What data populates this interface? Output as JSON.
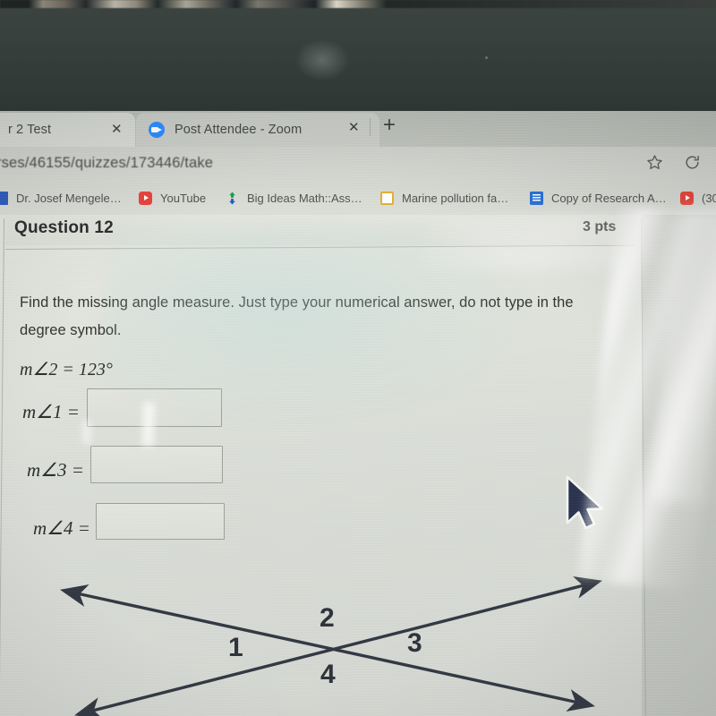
{
  "browser": {
    "tabs": [
      {
        "title": "r 2 Test",
        "favicon": "partial-tab-icon",
        "close_label": "✕",
        "active": false
      },
      {
        "title": "Post Attendee - Zoom",
        "favicon": "zoom-icon",
        "close_label": "✕",
        "active": true
      }
    ],
    "new_tab_label": "+",
    "url": "rses/46155/quizzes/173446/take",
    "toolbar_icons": [
      "bookmark-star-icon",
      "reload-icon"
    ],
    "bookmarks": [
      {
        "label": "Dr. Josef Mengele…",
        "icon": "blue-doc-icon"
      },
      {
        "label": "YouTube",
        "icon": "youtube-icon"
      },
      {
        "label": "Big Ideas Math::Ass…",
        "icon": "big-ideas-math-icon"
      },
      {
        "label": "Marine pollution fa…",
        "icon": "yellow-outline-doc-icon"
      },
      {
        "label": "Copy of Research A…",
        "icon": "google-docs-icon"
      },
      {
        "label": "(30",
        "icon": "youtube-icon"
      }
    ]
  },
  "quiz": {
    "question_title": "Question 12",
    "points": "3 pts",
    "prompt_line_1": "Find the missing angle measure.  Just type your numerical answer, do not type in the",
    "prompt_line_2": "degree symbol.",
    "given": "m∠2 = 123°",
    "answers": [
      {
        "label": "m∠1 =",
        "value": "",
        "placeholder": ""
      },
      {
        "label": "m∠3 =",
        "value": "",
        "placeholder": ""
      },
      {
        "label": "m∠4 =",
        "value": "",
        "placeholder": ""
      }
    ]
  },
  "diagram": {
    "description": "two-intersecting-lines",
    "angle_labels": [
      "1",
      "2",
      "3",
      "4"
    ]
  },
  "colors": {
    "zoom_blue": "#2d8cff",
    "youtube_red": "#e8453c",
    "docs_blue": "#2a72d8",
    "cursor": "#2c3550",
    "bezel": "#39423e",
    "page_bg": "#dfe1db"
  }
}
